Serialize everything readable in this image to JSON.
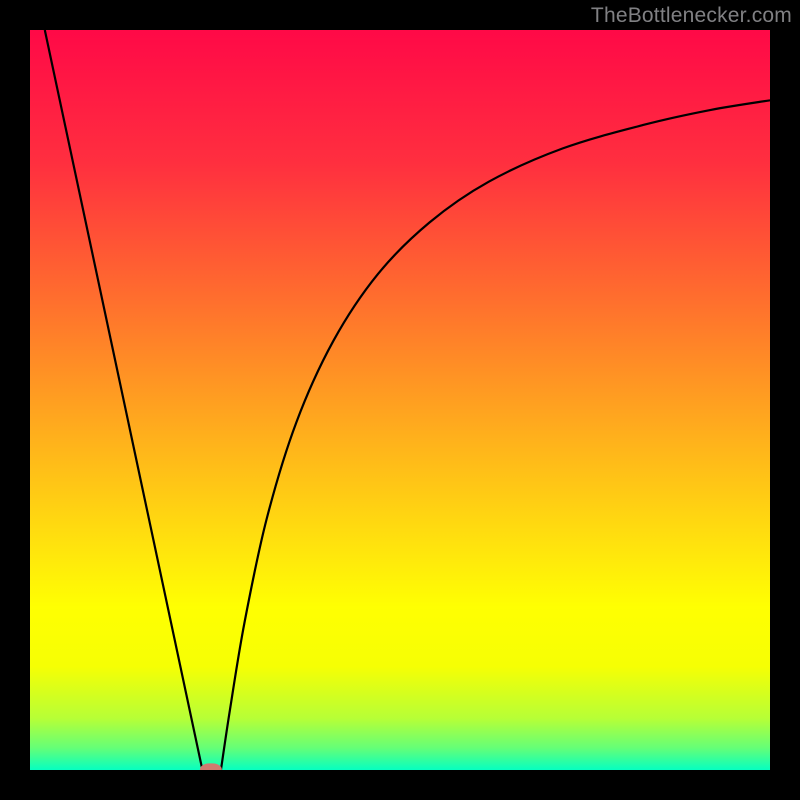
{
  "attribution": "TheBottlenecker.com",
  "chart_data": {
    "type": "line",
    "title": "",
    "xlabel": "",
    "ylabel": "",
    "xlim": [
      0,
      100
    ],
    "ylim": [
      0,
      100
    ],
    "gradient_stops": [
      {
        "pos": 0,
        "color": "#ff0947"
      },
      {
        "pos": 18,
        "color": "#ff2f3f"
      },
      {
        "pos": 36,
        "color": "#ff6d2e"
      },
      {
        "pos": 55,
        "color": "#ffb01c"
      },
      {
        "pos": 70,
        "color": "#ffe40d"
      },
      {
        "pos": 78,
        "color": "#ffff02"
      },
      {
        "pos": 86,
        "color": "#f6ff04"
      },
      {
        "pos": 93,
        "color": "#b7ff36"
      },
      {
        "pos": 97,
        "color": "#65ff77"
      },
      {
        "pos": 100,
        "color": "#06ffc1"
      }
    ],
    "series": [
      {
        "name": "left-branch",
        "x": [
          2.0,
          23.3
        ],
        "values": [
          100.0,
          0.0
        ]
      },
      {
        "name": "right-branch",
        "x": [
          25.8,
          27.0,
          29.0,
          32.0,
          36.0,
          41.0,
          47.0,
          54.0,
          62.0,
          72.0,
          83.0,
          92.0,
          100.0
        ],
        "values": [
          0.0,
          8.0,
          20.0,
          34.0,
          47.0,
          58.0,
          67.0,
          74.0,
          79.5,
          84.0,
          87.2,
          89.2,
          90.5
        ]
      }
    ],
    "marker": {
      "x": 24.5,
      "y": 0.0,
      "w_pct": 3.0,
      "h_pct": 1.8
    }
  }
}
